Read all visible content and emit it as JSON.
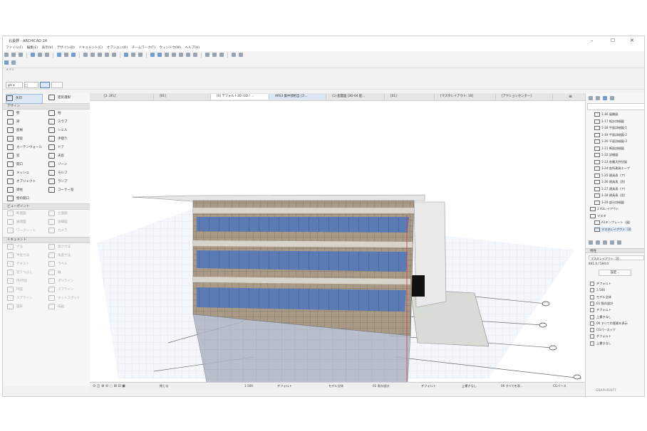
{
  "window": {
    "title": "北長野 - ARCHICAD 24",
    "controls": [
      "–",
      "☐",
      "✕"
    ]
  },
  "menu": [
    "ファイル(F)",
    "編集(E)",
    "表示(V)",
    "デザイン(D)",
    "ドキュメント(C)",
    "オプション(O)",
    "チームワーク(T)",
    "ウィンドウ(W)",
    "ヘルプ(H)"
  ],
  "toolbar": {
    "mini_label": "メイン",
    "selector_value": "ghi ▾",
    "layer_value": "□"
  },
  "tool_palette": {
    "arrow": "矢印",
    "marquee": "矩形選択",
    "design_header": "デザイン",
    "design_tools": [
      [
        "壁",
        "柱"
      ],
      [
        "梁",
        "スラブ"
      ],
      [
        "屋根",
        "シェル"
      ],
      [
        "階段",
        "手摺り"
      ],
      [
        "カーテンウォール",
        "ドア"
      ],
      [
        "窓",
        "天窓"
      ],
      [
        "開口",
        "ゾーン"
      ],
      [
        "メッシュ",
        "モルフ"
      ],
      [
        "オブジェクト",
        "ランプ"
      ],
      [
        "梁柱",
        "コーナー窓"
      ],
      [
        "壁の開口",
        ""
      ]
    ],
    "viewpoint_header": "ビューポイント",
    "viewpoint_tools": [
      [
        "断面図",
        "立面図"
      ],
      [
        "展開図",
        "詳細図"
      ],
      [
        "ワークシート",
        "カメラ"
      ]
    ],
    "document_header": "ドキュメント",
    "document_tools": [
      [
        "寸法",
        "高さ寸法"
      ],
      [
        "半径寸法",
        "角度寸法"
      ],
      [
        "テキスト",
        "ラベル"
      ],
      [
        "塗りつぶし",
        "線"
      ],
      [
        "円/円弧",
        "ポリライン"
      ],
      [
        "円弧",
        "スプライン"
      ],
      [
        "スプライン",
        "ホットスポット"
      ],
      [
        "図形",
        "描画"
      ]
    ]
  },
  "tabs": [
    "[3. 2FL]",
    "[01]",
    "[0] デフォルト3D (3D / ...",
    "ARS3 集中部相当 [ス...",
    "(1) 配置図 [3D-04 配...",
    "[01]",
    "[マスタレイアウト: 10]",
    "[アクションセンター]"
  ],
  "statusbar": [
    "閉じる",
    "1:500",
    "デフォルト",
    "モデル全体",
    "01 既存設計",
    "デフォルト",
    "上書きなし",
    "00 すべてを表...",
    "CGパース"
  ],
  "navigator": {
    "items": [
      "1-16 展開図",
      "1-17 矩計詳細図",
      "1-18 平面詳細図-1",
      "1-19 平面詳細図-2",
      "1-20 平面詳細図-3",
      "1-21 断面詳細図",
      "1-22 詳細図",
      "1-23 各種天井伏図",
      "1-24 各所建具キープ",
      "1-25 建具表（ア）",
      "1-26 建具表（窓）",
      "1-27 建具表（ア）",
      "1-28 建具表（窓）",
      "1-29 部分詳細図",
      "2 A3レイアウト",
      "マスタ",
      "A1テンプレート（図）",
      "マスタレイアウト: 10"
    ],
    "properties_label": "特性",
    "prop_name": "マスタレイアウト: 10",
    "prop_size": "841.0 / 594.0",
    "settings_button": "設定..."
  },
  "quick_options": [
    "デフォルト",
    "1:500",
    "モデル全体",
    "01 既存設計",
    "デフォルト",
    "上書きなし",
    "00 すべての要素を表示",
    "CGパースック",
    "デフォルト",
    "上書きなし"
  ],
  "brand": "GRAPHISOFT",
  "colors": {
    "accent": "#4a7fc1",
    "glass": "#5b7bb5",
    "wall": "#9c8f7d"
  }
}
